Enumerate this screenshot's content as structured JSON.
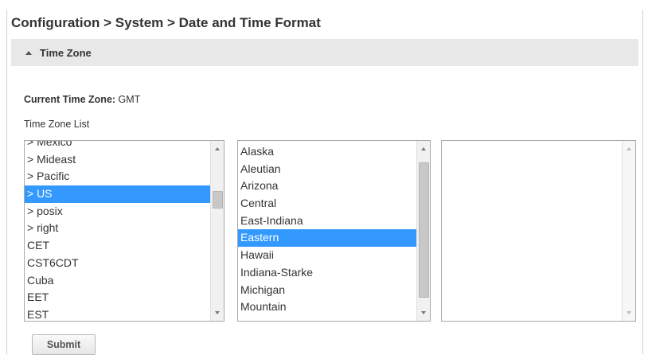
{
  "breadcrumb": "Configuration > System > Date and Time Format",
  "section": {
    "title": "Time Zone",
    "icon": "collapse-caret-icon"
  },
  "current_time_zone": {
    "label": "Current Time Zone:",
    "value": "GMT"
  },
  "time_zone_list_label": "Time Zone List",
  "region_list": {
    "items": [
      "> Mexico",
      "> Mideast",
      "> Pacific",
      "> US",
      "> posix",
      "> right",
      "CET",
      "CST6CDT",
      "Cuba",
      "EET",
      "EST"
    ],
    "selected": "> US"
  },
  "zone_list": {
    "items": [
      "Alaska",
      "Aleutian",
      "Arizona",
      "Central",
      "East-Indiana",
      "Eastern",
      "Hawaii",
      "Indiana-Starke",
      "Michigan",
      "Mountain"
    ],
    "selected": "Eastern"
  },
  "sub_list": {
    "items": []
  },
  "submit_label": "Submit",
  "colors": {
    "selection": "#3399ff",
    "section_bar": "#e8e8e8"
  }
}
